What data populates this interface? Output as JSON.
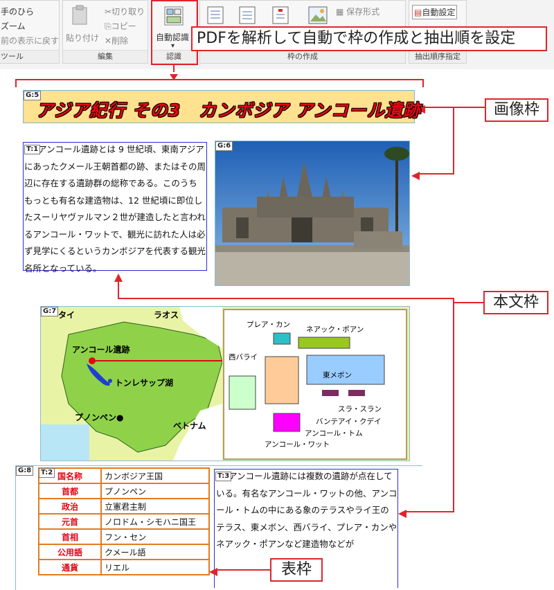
{
  "ribbon": {
    "tool_items": [
      "手のひら",
      "ズーム",
      "前の表示に戻す"
    ],
    "tool_group_label": "ツール",
    "edit": {
      "paste_label": "貼り付け",
      "cut_label": "切り取り",
      "copy_label": "コピー",
      "delete_label": "削除",
      "group_label": "編集"
    },
    "recognition": {
      "button_label": "自動認識",
      "arrow": "▾",
      "group_label": "認識"
    },
    "frame_create": {
      "save_format_label": "保存形式",
      "group_label": "枠の作成"
    },
    "order": {
      "auto_set_label": "自動設定",
      "group_label": "抽出順序指定"
    }
  },
  "tooltip": "PDFを解析して自動で枠の作成と抽出順を設定",
  "frames": {
    "g5": {
      "tag": "G:5",
      "title": "アジア紀行 その3　カンボジア アンコール遺跡"
    },
    "t1": {
      "tag": "T:1",
      "text": "アンコール遺跡とは 9 世紀頃、東南アジアにあったクメール王朝首都の跡、またはその周辺に存在する遺跡群の総称である。このうちもっとも有名な建造物は、12 世紀頃に即位したスーリヤヴァルマン２世が建造したと言われるアンコール・ワットで、観光に訪れた人は必ず見学にくるというカンボジアを代表する観光名所となっている。"
    },
    "g6": {
      "tag": "G:6"
    },
    "g7": {
      "tag": "G:7",
      "map_labels": {
        "thailand": "タイ",
        "laos": "ラオス",
        "angkor": "アンコール遺跡",
        "tonle_sap": "トンレサップ湖",
        "phnom_penh": "プノンペン●",
        "vietnam": "ベトナム"
      },
      "site_labels": {
        "preah_khan": "プレア・カン",
        "neak_pean": "ネアック・ポアン",
        "west_baray": "西バライ",
        "east_mebon": "東メボン",
        "srah_srang": "スラ・スラン",
        "banteay_kdei": "バンテアイ・クデイ",
        "angkor_thom": "アンコール・トム",
        "angkor_wat": "アンコール・ワット"
      }
    },
    "g8": {
      "tag": "G:8",
      "table_tag": "T:2",
      "rows": [
        {
          "key": "国名称",
          "value": "カンボジア王国"
        },
        {
          "key": "首都",
          "value": "プノンペン"
        },
        {
          "key": "政治",
          "value": "立憲君主制"
        },
        {
          "key": "元首",
          "value": "ノロドム・シモハニ国王"
        },
        {
          "key": "首相",
          "value": "フン・セン"
        },
        {
          "key": "公用語",
          "value": "クメール語"
        },
        {
          "key": "通貨",
          "value": "リエル"
        }
      ]
    },
    "t3": {
      "tag": "T:3",
      "text": "アンコール遺跡には複数の遺跡が点在している。有名なアンコール・ワットの他、アンコール・トムの中にある象のテラスやライ王のテラス、東メボン、西バライ、プレア・カンやネアック・ポアンなど建造物などが"
    }
  },
  "callouts": {
    "image_frame": "画像枠",
    "text_frame": "本文枠",
    "table_frame": "表枠"
  },
  "colors": {
    "accent_red": "#e0242c",
    "text_frame_blue": "#2b2bd8",
    "table_border_orange": "#e07b22",
    "title_fill": "#ffe28f"
  }
}
